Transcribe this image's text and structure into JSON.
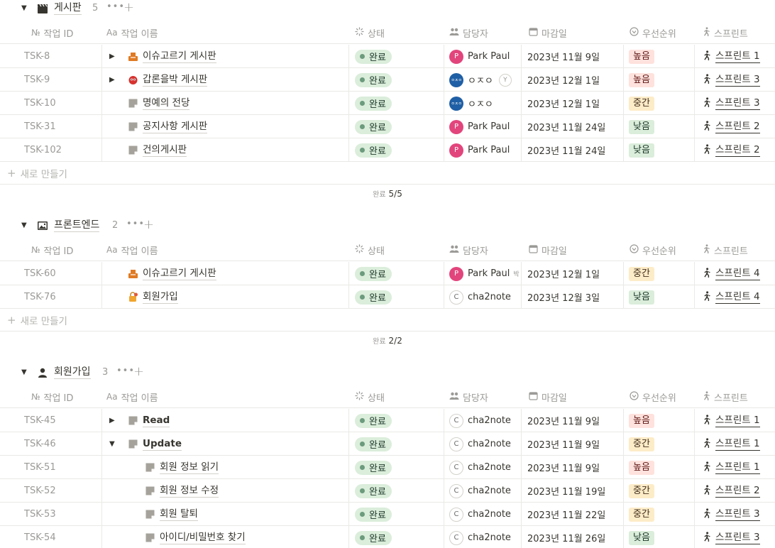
{
  "columns": {
    "id": "작업 ID",
    "title": "작업 이름",
    "status": "상태",
    "assignee": "담당자",
    "due": "마감일",
    "priority": "우선순위",
    "sprint": "스프린트"
  },
  "column_icons": {
    "id": "№",
    "title": "Aa"
  },
  "new_label": "새로 만들기",
  "calc_label": "완료",
  "colors": {
    "status_done_bg": "#dbeddb",
    "priority_high_bg": "#ffe2dd",
    "priority_mid_bg": "#fdecc8",
    "priority_low_bg": "#dbeddb",
    "avatar_pink": "#e2457c"
  },
  "groups": [
    {
      "title": "게시판",
      "icon": "clapperboard-icon",
      "count": "5",
      "calc": "5/5",
      "rows": [
        {
          "id": "TSK-8",
          "title": "이슈고르기 게시판",
          "toggle": "▶",
          "icon": "box-icon",
          "status": "완료",
          "assignee": "Park Paul",
          "avatar": "P",
          "avatar_kind": "pink",
          "due": "2023년 11월 9일",
          "priority": "높음",
          "sprint": "스프린트 1"
        },
        {
          "id": "TSK-9",
          "title": "갑론을박 게시판",
          "toggle": "▶",
          "icon": "crab-icon",
          "status": "완료",
          "assignee": "ㅇㅈㅇ",
          "avatar": "ㅇㅈㅇ",
          "avatar_kind": "blue",
          "extra_avatar": "Y",
          "due": "2023년 12월 1일",
          "priority": "높음",
          "sprint": "스프린트 3"
        },
        {
          "id": "TSK-10",
          "title": "명예의 전당",
          "toggle": "",
          "icon": "page-icon",
          "status": "완료",
          "assignee": "ㅇㅈㅇ",
          "avatar": "ㅇㅈㅇ",
          "avatar_kind": "blue",
          "due": "2023년 12월 1일",
          "priority": "중간",
          "sprint": "스프린트 3"
        },
        {
          "id": "TSK-31",
          "title": "공지사항 게시판",
          "toggle": "",
          "icon": "page-icon",
          "status": "완료",
          "assignee": "Park Paul",
          "avatar": "P",
          "avatar_kind": "pink",
          "due": "2023년 11월 24일",
          "priority": "낮음",
          "sprint": "스프린트 2"
        },
        {
          "id": "TSK-102",
          "title": "건의게시판",
          "toggle": "",
          "icon": "page-icon",
          "status": "완료",
          "assignee": "Park Paul",
          "avatar": "P",
          "avatar_kind": "pink",
          "due": "2023년 11월 24일",
          "priority": "낮음",
          "sprint": "스프린트 2"
        }
      ]
    },
    {
      "title": "프론트엔드",
      "icon": "image-icon",
      "count": "2",
      "calc": "2/2",
      "rows": [
        {
          "id": "TSK-60",
          "title": "이슈고르기 게시판",
          "toggle": "",
          "icon": "box-icon",
          "status": "완료",
          "assignee": "Park Paul",
          "avatar": "P",
          "avatar_kind": "pink",
          "extra_text": "박",
          "due": "2023년 12월 1일",
          "priority": "중간",
          "sprint": "스프린트 4"
        },
        {
          "id": "TSK-76",
          "title": "회원가입",
          "toggle": "",
          "icon": "lock-icon",
          "status": "완료",
          "assignee": "cha2note",
          "avatar": "C",
          "avatar_kind": "outline",
          "due": "2023년 12월 3일",
          "priority": "낮음",
          "sprint": "스프린트 4"
        }
      ]
    },
    {
      "title": "회원가입",
      "icon": "person-icon",
      "count": "3",
      "calc": "",
      "rows": [
        {
          "id": "TSK-45",
          "title": "Read",
          "toggle": "▶",
          "icon": "page-icon",
          "bold": true,
          "status": "완료",
          "assignee": "cha2note",
          "avatar": "C",
          "avatar_kind": "outline",
          "due": "2023년 11월 9일",
          "priority": "높음",
          "sprint": "스프린트 1"
        },
        {
          "id": "TSK-46",
          "title": "Update",
          "toggle": "▼",
          "icon": "page-icon",
          "bold": true,
          "status": "완료",
          "assignee": "cha2note",
          "avatar": "C",
          "avatar_kind": "outline",
          "due": "2023년 11월 9일",
          "priority": "중간",
          "sprint": "스프린트 1"
        },
        {
          "id": "TSK-51",
          "title": "회원 정보 읽기",
          "toggle": "",
          "icon": "page-icon",
          "indent": true,
          "status": "완료",
          "assignee": "cha2note",
          "avatar": "C",
          "avatar_kind": "outline",
          "due": "2023년 11월 9일",
          "priority": "높음",
          "sprint": "스프린트 1"
        },
        {
          "id": "TSK-52",
          "title": "회원 정보 수정",
          "toggle": "",
          "icon": "page-icon",
          "indent": true,
          "status": "완료",
          "assignee": "cha2note",
          "avatar": "C",
          "avatar_kind": "outline",
          "due": "2023년 11월 19일",
          "priority": "중간",
          "sprint": "스프린트 2"
        },
        {
          "id": "TSK-53",
          "title": "회원 탈퇴",
          "toggle": "",
          "icon": "page-icon",
          "indent": true,
          "status": "완료",
          "assignee": "cha2note",
          "avatar": "C",
          "avatar_kind": "outline",
          "due": "2023년 11월 22일",
          "priority": "중간",
          "sprint": "스프린트 3"
        },
        {
          "id": "TSK-54",
          "title": "아이디/비밀번호 찾기",
          "toggle": "",
          "icon": "page-icon",
          "indent": true,
          "status": "완료",
          "assignee": "cha2note",
          "avatar": "C",
          "avatar_kind": "outline",
          "due": "2023년 11월 26일",
          "priority": "낮음",
          "sprint": "스프린트 3"
        }
      ]
    }
  ]
}
